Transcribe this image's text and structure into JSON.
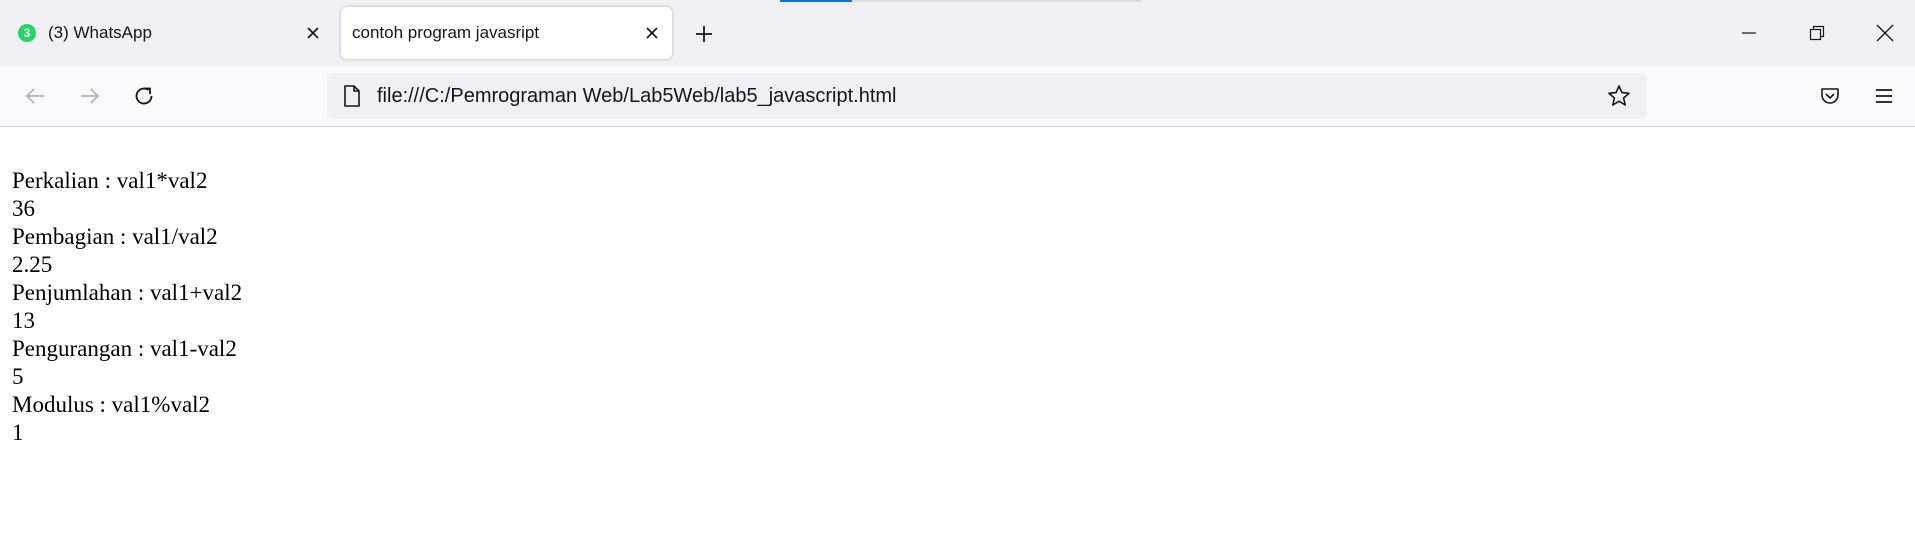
{
  "browser": {
    "tabs": [
      {
        "label": "(3) WhatsApp",
        "badge": "3",
        "active": false
      },
      {
        "label": "contoh program javasript",
        "active": true
      }
    ],
    "url": "file:///C:/Pemrograman Web/Lab5Web/lab5_javascript.html"
  },
  "page": {
    "lines": [
      "Perkalian : val1*val2",
      "36",
      "Pembagian : val1/val2",
      "2.25",
      "Penjumlahan : val1+val2",
      "13",
      "Pengurangan : val1-val2",
      "5",
      "Modulus : val1%val2",
      "1"
    ]
  },
  "colors": {
    "tab_strip": "#f0f0f4",
    "toolbar": "#f9f9fb",
    "whatsapp_badge": "#25d366",
    "loading_accent": "#0a74d8"
  },
  "icons": [
    "whatsapp-badge-icon",
    "close-icon",
    "plus-icon",
    "minimize-icon",
    "restore-icon",
    "window-close-icon",
    "back-arrow-icon",
    "forward-arrow-icon",
    "reload-icon",
    "page-icon",
    "star-icon",
    "pocket-icon",
    "hamburger-menu-icon"
  ]
}
